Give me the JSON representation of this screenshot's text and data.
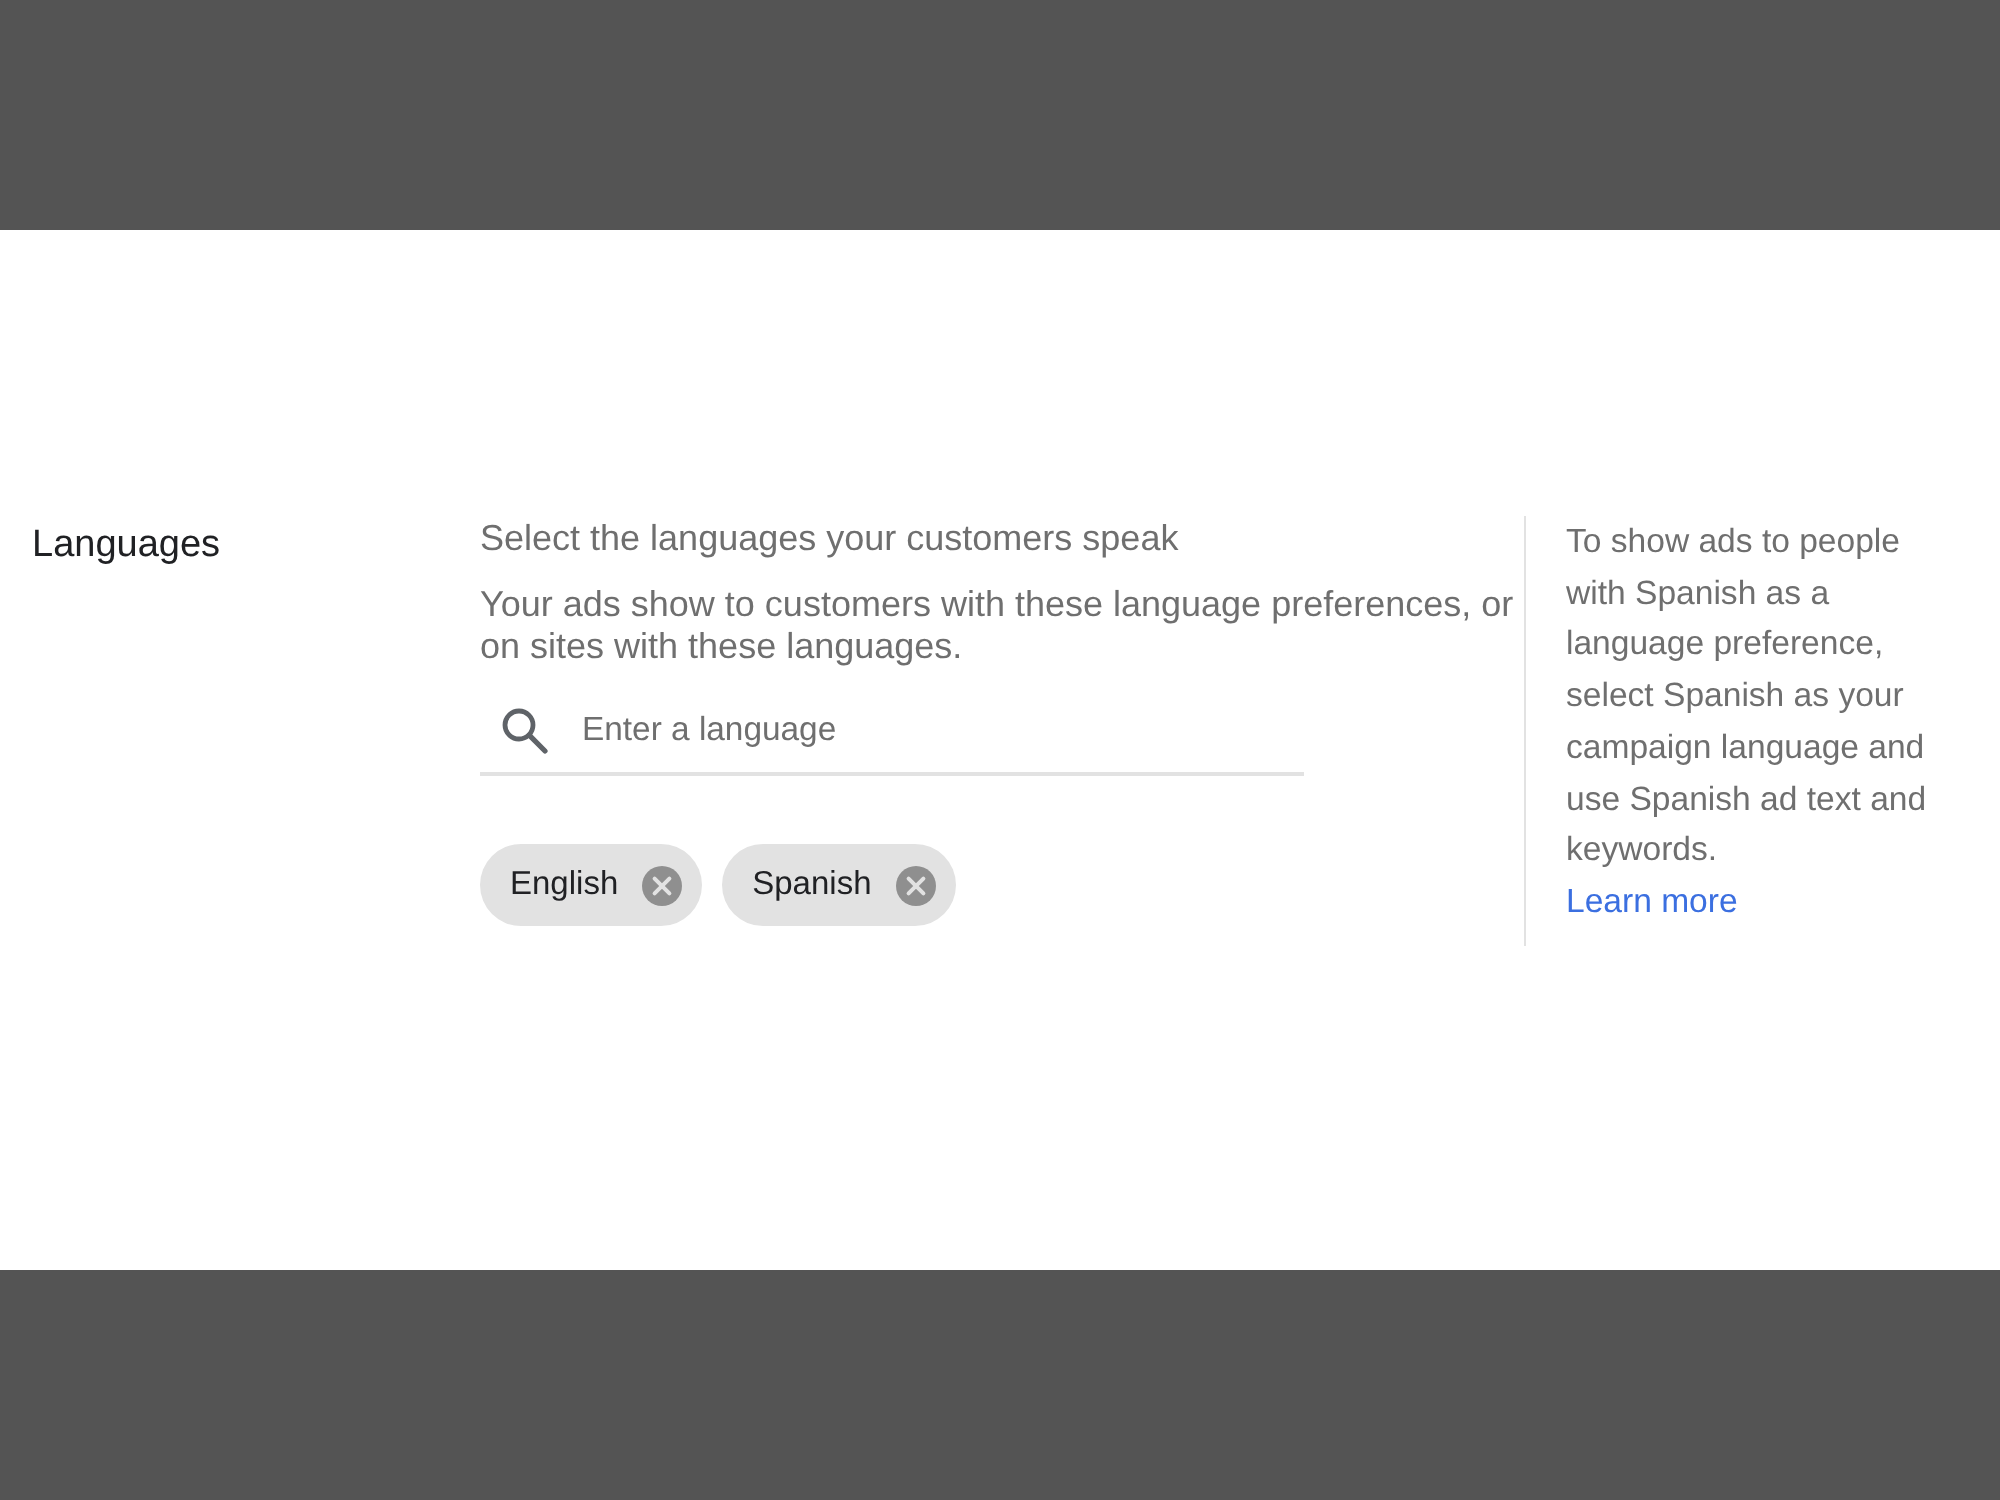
{
  "setting": {
    "label": "Languages",
    "prompt": "Select the languages your customers speak",
    "description": "Your ads show to customers with these language preferences, or on sites with these languages.",
    "search": {
      "placeholder": "Enter a language"
    },
    "chips": [
      {
        "label": "English"
      },
      {
        "label": "Spanish"
      }
    ]
  },
  "help": {
    "text": "To show ads to people with Spanish as a language preference, select Spanish as your campaign language and use Spanish ad text and keywords.",
    "link": "Learn more"
  }
}
